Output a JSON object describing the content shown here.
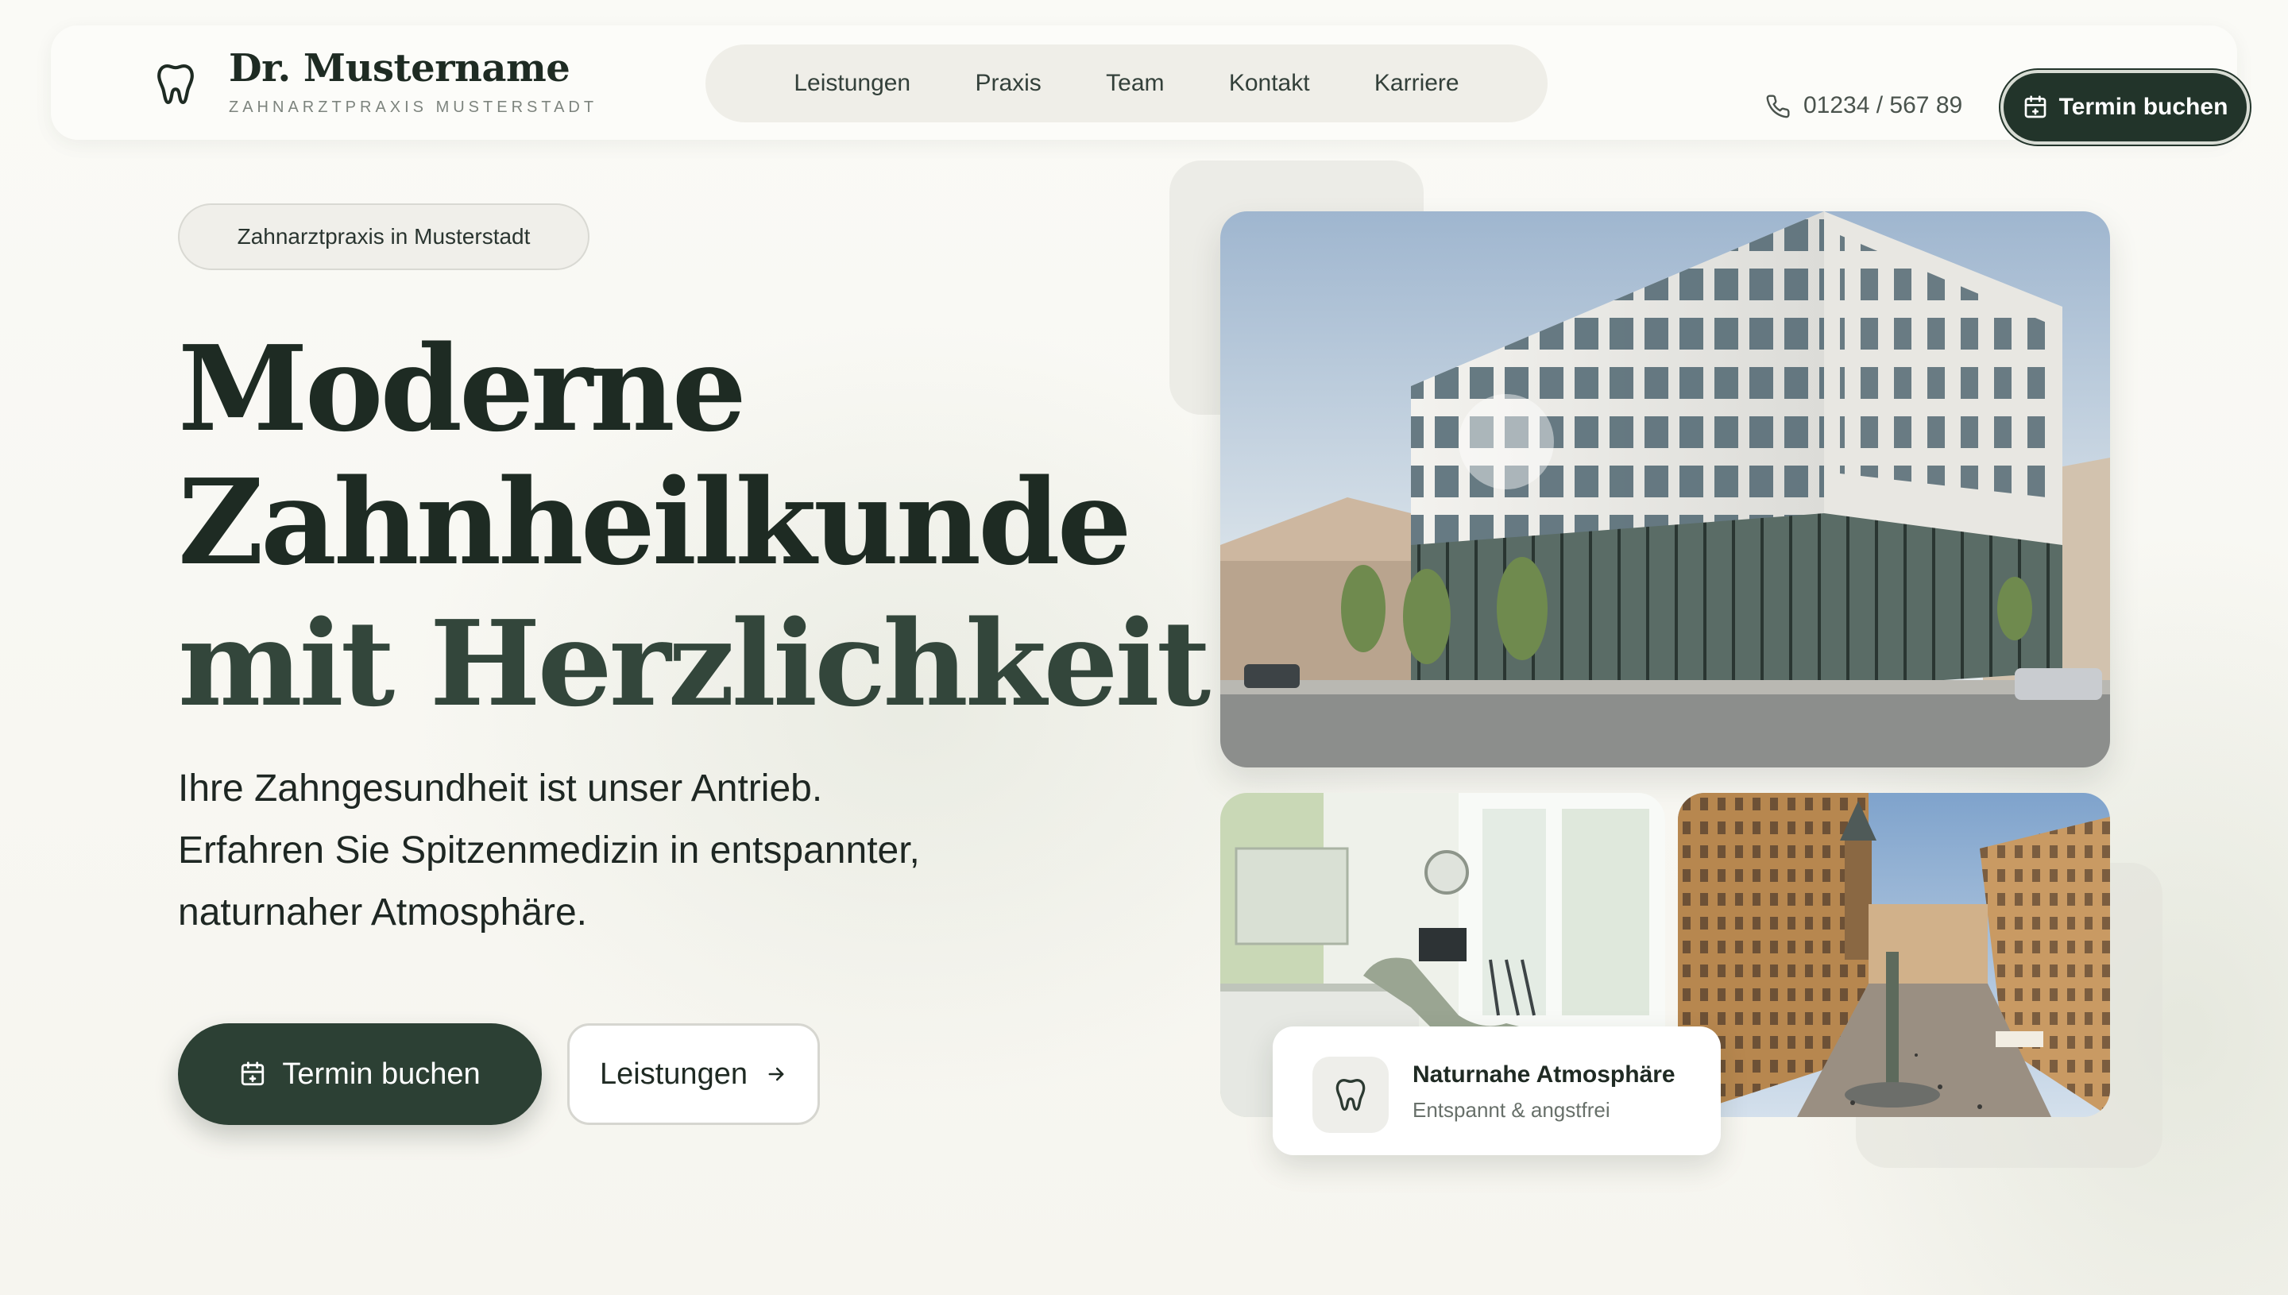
{
  "brand": {
    "name": "Dr. Mustername",
    "subtitle": "ZAHNARZTPRAXIS MUSTERSTADT",
    "icon": "tooth-icon"
  },
  "nav": {
    "items": [
      {
        "label": "Leistungen"
      },
      {
        "label": "Praxis"
      },
      {
        "label": "Team"
      },
      {
        "label": "Kontakt"
      },
      {
        "label": "Karriere"
      }
    ],
    "phone": "01234 / 567 89",
    "phone_icon": "phone-icon",
    "cta_label": "Termin buchen",
    "cta_icon": "calendar-icon"
  },
  "hero": {
    "badge": "Zahnarztpraxis in Musterstadt",
    "headline": [
      "Moderne",
      "Zahnheilkunde",
      "mit Herzlichkeit"
    ],
    "lead": [
      "Ihre Zahngesundheit ist unser Antrieb.",
      "Erfahren Sie Spitzenmedizin in entspannter,",
      "naturnaher Atmosphäre."
    ],
    "primary_cta": "Termin buchen",
    "secondary_cta": "Leistungen",
    "secondary_icon": "arrow-right-icon"
  },
  "info_card": {
    "title": "Naturnahe Atmosphäre",
    "subtitle": "Entspannt & angstfrei",
    "icon": "tooth-icon"
  },
  "colors": {
    "accent": "#22342a",
    "primary_button": "#2c4034",
    "background": "#f7f6f1"
  }
}
